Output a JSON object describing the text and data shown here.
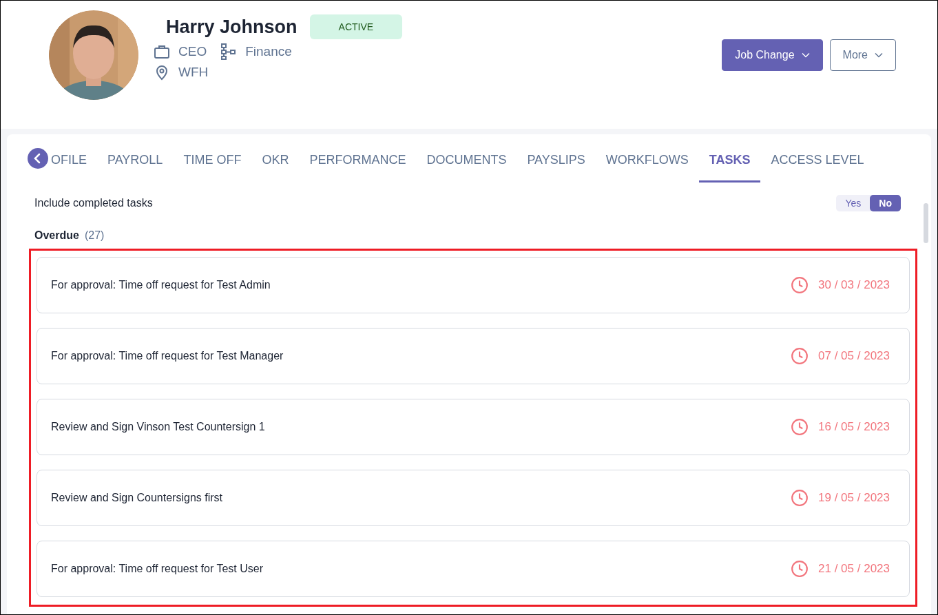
{
  "profile": {
    "name": "Harry Johnson",
    "status": "ACTIVE",
    "role": "CEO",
    "department": "Finance",
    "location": "WFH"
  },
  "actions": [
    "Job Change",
    "More"
  ],
  "tabs": [
    {
      "label": "OFILE",
      "selected": false
    },
    {
      "label": "PAYROLL",
      "selected": false
    },
    {
      "label": "TIME OFF",
      "selected": false
    },
    {
      "label": "OKR",
      "selected": false
    },
    {
      "label": "PERFORMANCE",
      "selected": false
    },
    {
      "label": "DOCUMENTS",
      "selected": false
    },
    {
      "label": "PAYSLIPS",
      "selected": false
    },
    {
      "label": "WORKFLOWS",
      "selected": false
    },
    {
      "label": "TASKS",
      "selected": true
    },
    {
      "label": "ACCESS LEVEL",
      "selected": false
    }
  ],
  "include_completed": {
    "label": "Include completed tasks",
    "options": [
      {
        "label": "Yes",
        "selected": false
      },
      {
        "label": "No",
        "selected": true
      }
    ]
  },
  "overdue": {
    "title": "Overdue",
    "count": "(27)",
    "highlighted": true,
    "tasks": [
      {
        "title": "For approval: Time off request for Test Admin",
        "due": "30 / 03 / 2023"
      },
      {
        "title": "For approval: Time off request for Test Manager",
        "due": "07 / 05 / 2023"
      },
      {
        "title": "Review and Sign Vinson Test Countersign 1",
        "due": "16 / 05 / 2023"
      },
      {
        "title": "Review and Sign Countersigns first",
        "due": "19 / 05 / 2023"
      },
      {
        "title": "For approval: Time off request for Test User",
        "due": "21 / 05 / 2023"
      }
    ]
  }
}
